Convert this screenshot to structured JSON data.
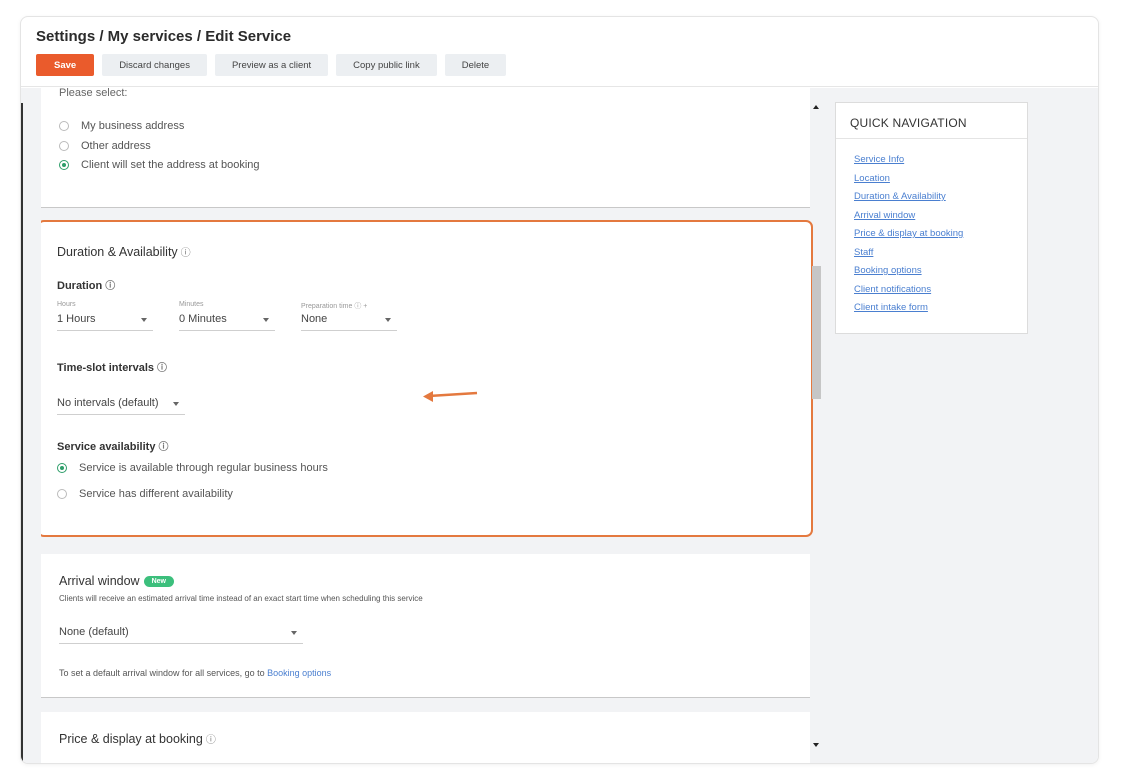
{
  "header": {
    "breadcrumb": "Settings / My services / Edit Service",
    "buttons": {
      "save": "Save",
      "discard": "Discard changes",
      "preview": "Preview as a client",
      "copy_link": "Copy public link",
      "delete": "Delete"
    }
  },
  "location": {
    "prompt": "Please select:",
    "options": [
      {
        "label": "My business address",
        "selected": false
      },
      {
        "label": "Other address",
        "selected": false
      },
      {
        "label": "Client will set the address at booking",
        "selected": true
      }
    ]
  },
  "duration_availability": {
    "title": "Duration & Availability",
    "duration_label": "Duration",
    "hours_label": "Hours",
    "hours_value": "1 Hours",
    "minutes_label": "Minutes",
    "minutes_value": "0 Minutes",
    "prep_label": "Preparation time",
    "prep_suffix": "+",
    "prep_value": "None",
    "timeslot_label": "Time-slot intervals",
    "timeslot_value": "No intervals (default)",
    "availability_label": "Service availability",
    "availability_options": [
      {
        "label": "Service is available through regular business hours",
        "selected": true
      },
      {
        "label": "Service has different availability",
        "selected": false
      }
    ],
    "highlight_color": "#e4793f"
  },
  "arrival_window": {
    "title": "Arrival window",
    "badge": "New",
    "description": "Clients will receive an estimated arrival time instead of an exact start time when scheduling this service",
    "select_value": "None (default)",
    "footer_text": "To set a default arrival window for all services, go to",
    "footer_link": "Booking options"
  },
  "price_display": {
    "title": "Price & display at booking"
  },
  "quick_navigation": {
    "title": "QUICK NAVIGATION",
    "items": [
      "Service Info",
      "Location",
      "Duration & Availability",
      "Arrival window",
      "Price & display at booking",
      "Staff",
      "Booking options",
      "Client notifications",
      "Client intake form"
    ]
  },
  "colors": {
    "accent": "#ea5b2c",
    "link": "#4a7fd0",
    "radio_selected": "#2e9e6a",
    "badge": "#3cbf7c"
  },
  "icons": {
    "help": "help-circle-icon",
    "caret": "chevron-down-icon",
    "annotation_arrow": "arrow-left-icon"
  }
}
